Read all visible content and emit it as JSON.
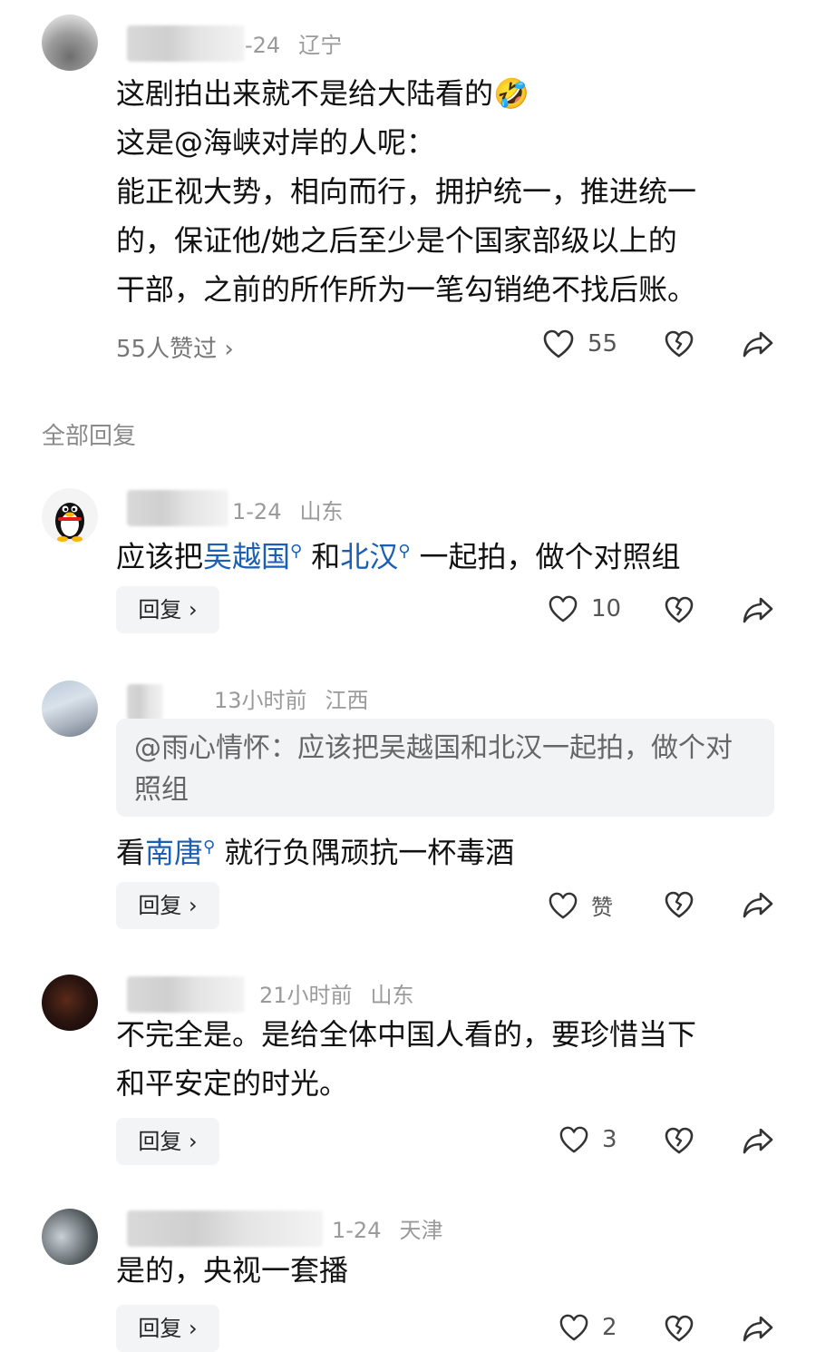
{
  "top_comment": {
    "meta_time": "-24",
    "meta_location": "辽宁",
    "text_lines": [
      "这剧拍出来就不是给大陆看的",
      "这是@海峡对岸的人呢：",
      "能正视大势，相向而行，拥护统一，推进统一",
      "的，保证他/她之后至少是个国家部级以上的",
      "干部，之前的所作所为一笔勾销绝不找后账。"
    ],
    "emoji": "🤣",
    "likes_link": "55人赞过 ›",
    "like_count": "55"
  },
  "section_title": "全部回复",
  "replies": [
    {
      "time": "1-24",
      "location": "山东",
      "text_a": "应该把",
      "link_1": "吴越国",
      "text_b": "和",
      "link_2": "北汉",
      "text_c": "一起拍，做个对照组",
      "reply_label": "回复 ›",
      "like_count": "10"
    },
    {
      "time": "13小时前",
      "location": "江西",
      "quote": "@雨心情怀：应该把吴越国和北汉一起拍，做个对照组",
      "text_a": "看",
      "link_1": "南唐",
      "text_b": "就行负隅顽抗一杯毒酒",
      "reply_label": "回复 ›",
      "like_label": "赞"
    },
    {
      "time": "21小时前",
      "location": "山东",
      "text_lines": [
        "不完全是。是给全体中国人看的，要珍惜当下",
        "和平安定的时光。"
      ],
      "reply_label": "回复 ›",
      "like_count": "3"
    },
    {
      "time": "1-24",
      "location": "天津",
      "text": "是的，央视一套播",
      "reply_label": "回复 ›",
      "like_count": "2"
    }
  ],
  "icons": [
    "heart-icon",
    "broken-heart-icon",
    "share-icon",
    "search-icon",
    "qq-penguin-avatar"
  ],
  "colors": {
    "link": "#1a5fb4",
    "meta": "#9a9a9a",
    "reply_bg": "#f3f4f6",
    "quote_bg": "#f2f3f5"
  }
}
